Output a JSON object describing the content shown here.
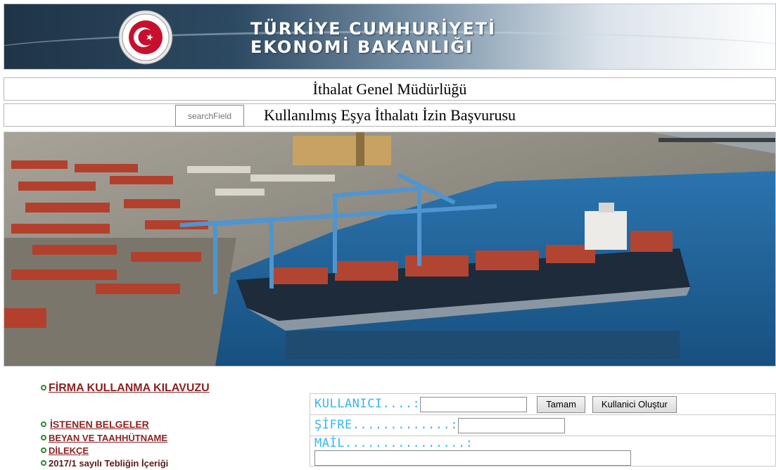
{
  "banner": {
    "line1": "TÜRKİYE CUMHURİYETİ",
    "line2": "EKONOMİ BAKANLIĞI",
    "emblem_colors": {
      "red": "#c8102e",
      "white": "#ffffff"
    }
  },
  "department": "İthalat Genel Müdürlüğü",
  "page_title": "Kullanılmış Eşya İthalatı İzin Başvurusu",
  "search": {
    "placeholder": "searchField"
  },
  "photo": {
    "subject": "container-port-ship"
  },
  "links": {
    "manual": "FİRMA KULLANMA KILAVUZU",
    "items": [
      "İSTENEN BELGELER",
      "BEYAN VE TAAHHÜTNAME",
      "DİLEKÇE",
      "2017/1 sayılı Tebliğin İçeriği"
    ]
  },
  "form": {
    "user_label": "KULLANICI....:",
    "password_label": "ŞİFRE.............:",
    "mail_label": "MAİL................:",
    "ok_button": "Tamam",
    "create_button": "Kullanici Oluştur"
  },
  "colors": {
    "link": "#8b2323",
    "label": "#36b7f0",
    "bullet": "#2b8a2b"
  }
}
